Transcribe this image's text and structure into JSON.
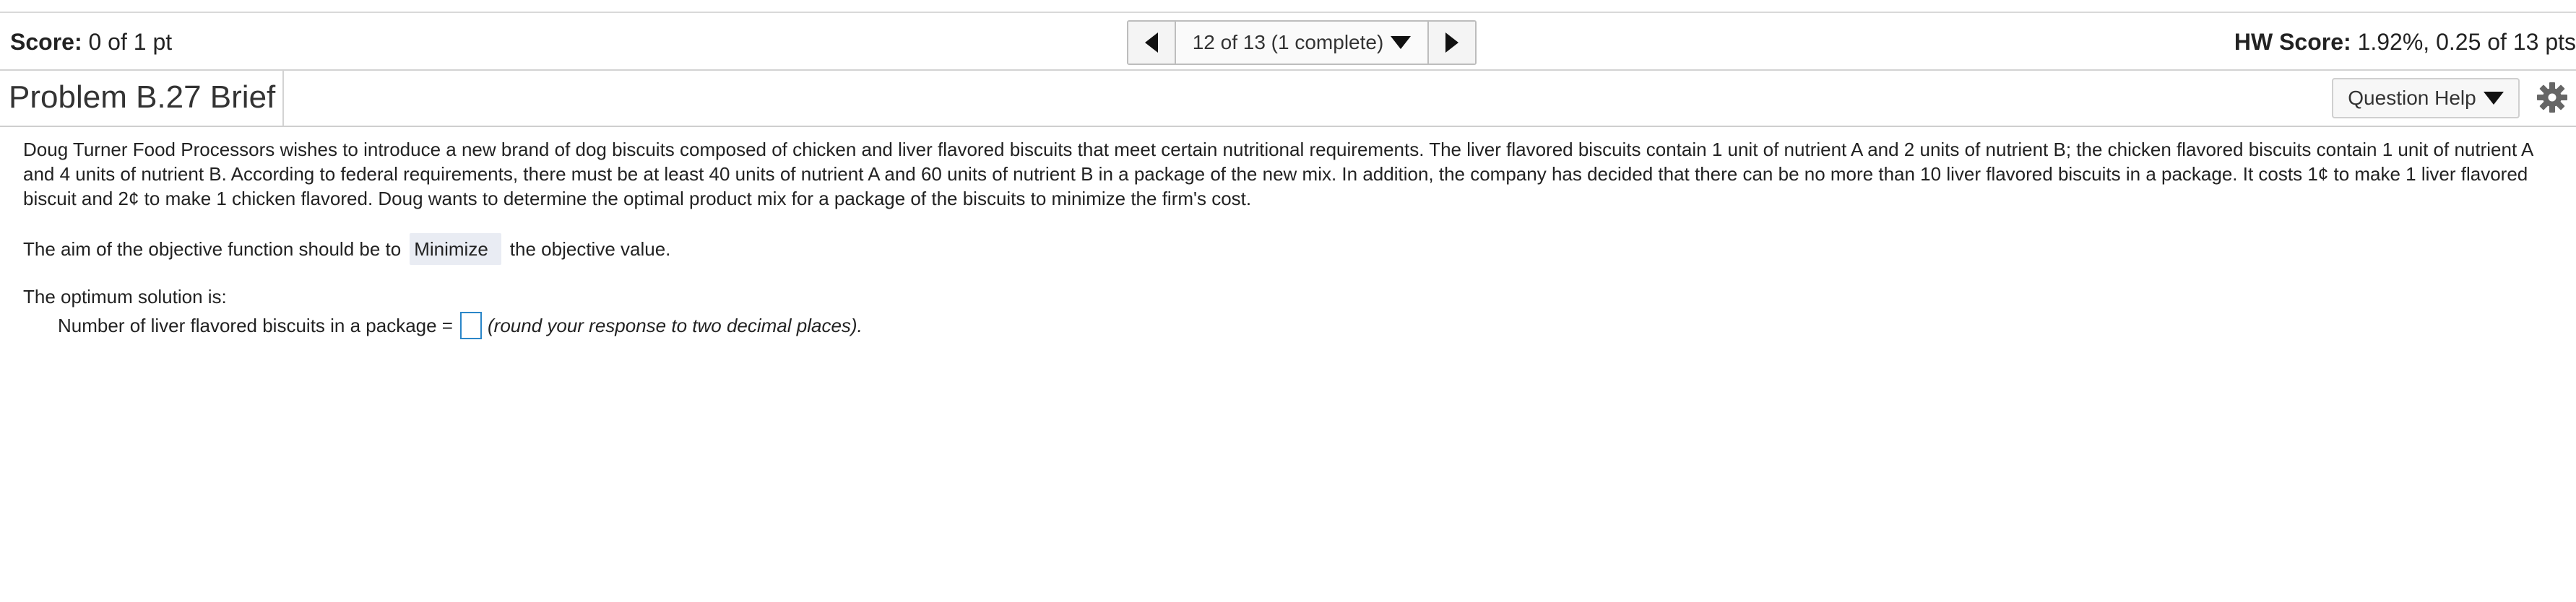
{
  "header": {
    "score_label": "Score:",
    "score_value": "0 of 1 pt",
    "nav_counter": "12 of 13 (1 complete)",
    "hw_score_label": "HW Score:",
    "hw_score_value": "1.92%, 0.25 of 13 pts"
  },
  "problem": {
    "title": "Problem B.27 Brief",
    "help_label": "Question Help",
    "statement": "Doug Turner Food Processors wishes to introduce a new brand of dog biscuits composed of chicken and liver flavored biscuits that meet certain nutritional requirements.  The liver flavored biscuits contain 1 unit of nutrient A and 2 units of nutrient B; the chicken flavored biscuits contain 1 unit of nutrient A and 4 units of nutrient B.  According to federal requirements, there must be at least 40 units of nutrient A and 60 units of nutrient B in a package of the new mix.  In addition, the company has decided that there can be no more than 10 liver flavored biscuits in a package.  It costs 1¢ to make 1 liver flavored biscuit and 2¢ to make 1 chicken flavored.  Doug wants to determine the optimal product mix for a package of the biscuits to minimize the firm's cost.",
    "aim_prefix": "The aim of the objective function should be to",
    "aim_selected": "Minimize",
    "aim_suffix": "the objective value.",
    "optimum_label": "The optimum solution is:",
    "liver_label": "Number of liver flavored biscuits in a package =",
    "liver_value": "",
    "round_hint": "(round your response to two decimal places)."
  },
  "icons": {
    "prev": "triangle-left-icon",
    "next": "triangle-right-icon",
    "dropdown": "triangle-down-icon",
    "settings": "gear-icon"
  }
}
